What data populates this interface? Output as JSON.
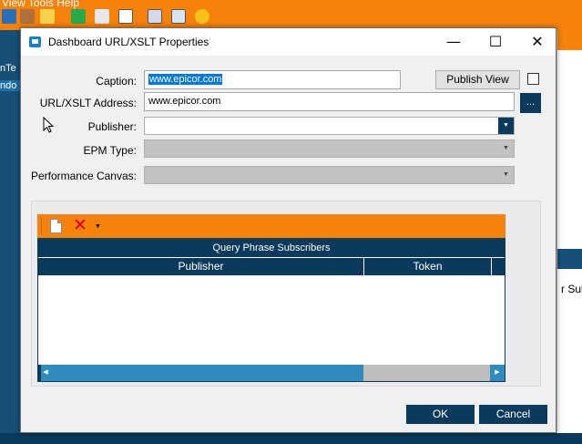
{
  "background": {
    "menu_text": "View   Tools   Help",
    "left_edge": [
      "nTe",
      "ndo"
    ],
    "right_edge_text": "r Sub"
  },
  "dialog": {
    "title": "Dashboard URL/XSLT Properties",
    "controls": {
      "minimize": "—",
      "maximize": "☐",
      "close": "✕"
    }
  },
  "form": {
    "caption_label": "Caption:",
    "caption_value": "www.epicor.com",
    "url_label": "URL/XSLT Address:",
    "url_value": "www.epicor.com",
    "publisher_label": "Publisher:",
    "publisher_value": "",
    "epm_label": "EPM Type:",
    "epm_value": "",
    "canvas_label": "Performance Canvas:",
    "canvas_value": "",
    "publish_view_label": "Publish View",
    "publish_view_checked": false,
    "browse_label": "..."
  },
  "grid": {
    "caption": "Query Phrase Subscribers",
    "columns": [
      "Publisher",
      "Token"
    ],
    "rows": []
  },
  "buttons": {
    "ok": "OK",
    "cancel": "Cancel"
  },
  "colors": {
    "accent": "#f5820c",
    "navy": "#0b3a5c",
    "scroll": "#2f8cbd"
  }
}
